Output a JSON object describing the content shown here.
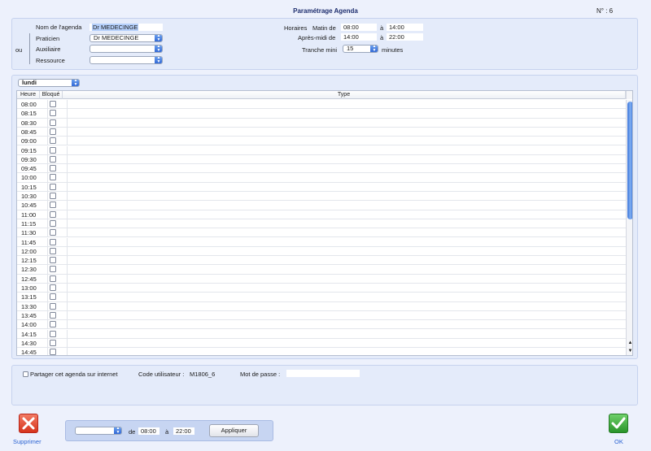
{
  "header": {
    "title": "Paramétrage Agenda",
    "number": "N° : 6"
  },
  "config": {
    "agenda_name_label": "Nom de l'agenda",
    "agenda_name_value": "Dr MEDECINGE",
    "ou_label": "ou",
    "praticien_label": "Praticien",
    "praticien_value": "Dr MEDECINGE",
    "auxiliaire_label": "Auxiliaire",
    "auxiliaire_value": "",
    "ressource_label": "Ressource",
    "ressource_value": "",
    "horaires_label": "Horaires",
    "matin_label": "Matin de",
    "matin_from": "08:00",
    "a_label": "à",
    "matin_to": "14:00",
    "apres_midi_label": "Après-midi de",
    "apres_midi_from": "14:00",
    "apres_midi_to": "22:00",
    "tranche_label": "Tranche mini",
    "tranche_value": "15",
    "minutes_label": "minutes"
  },
  "grid": {
    "day_value": "lundi",
    "columns": [
      "Heure",
      "Bloqué",
      "Type"
    ],
    "rows": [
      "08:00",
      "08:15",
      "08:30",
      "08:45",
      "09:00",
      "09:15",
      "09:30",
      "09:45",
      "10:00",
      "10:15",
      "10:30",
      "10:45",
      "11:00",
      "11:15",
      "11:30",
      "11:45",
      "12:00",
      "12:15",
      "12:30",
      "12:45",
      "13:00",
      "13:15",
      "13:30",
      "13:45",
      "14:00",
      "14:15",
      "14:30",
      "14:45"
    ]
  },
  "share": {
    "share_label": "Partager cet agenda sur internet",
    "code_label": "Code utilisateur :",
    "code_value": "M1806_6",
    "password_label": "Mot de passe :",
    "password_value": ""
  },
  "footer": {
    "delete_label": "Supprimer",
    "de_label": "de",
    "from_value": "08:00",
    "a_label": "à",
    "to_value": "22:00",
    "apply_label": "Appliquer",
    "ok_label": "OK",
    "colors": {
      "delete_red": "#e0442c",
      "ok_green": "#2e9e2b",
      "accent_blue": "#2a62d2"
    }
  }
}
